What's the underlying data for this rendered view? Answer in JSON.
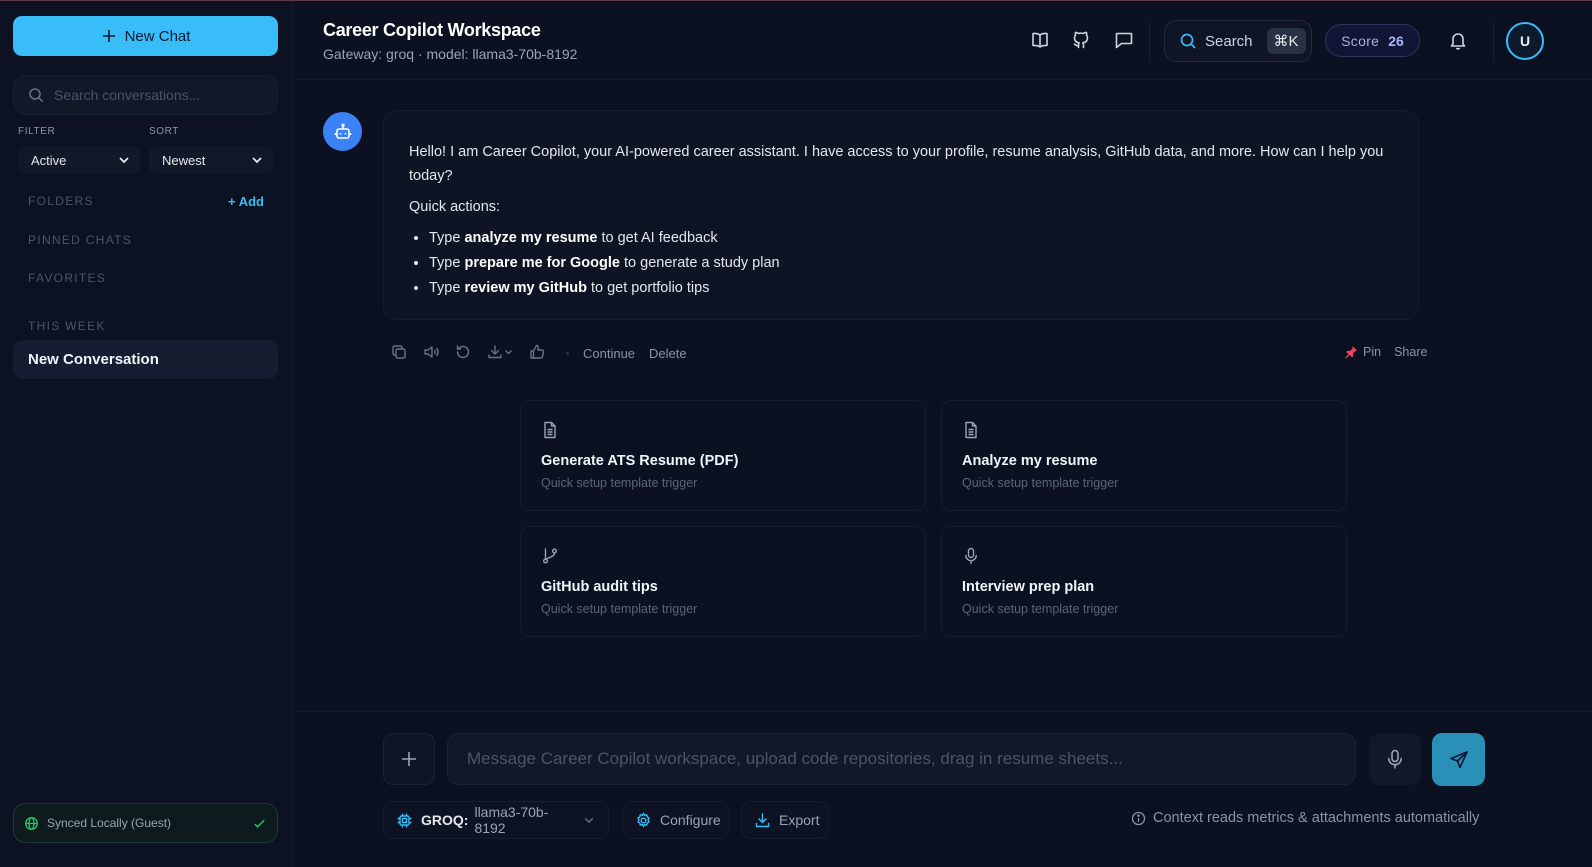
{
  "sidebar": {
    "new_chat_label": "New Chat",
    "search_placeholder": "Search conversations...",
    "filter_label": "FILTER",
    "sort_label": "SORT",
    "filter_value": "Active",
    "sort_value": "Newest",
    "folders_label": "FOLDERS",
    "add_label": "+ Add",
    "pinned_label": "PINNED CHATS",
    "favorites_label": "FAVORITES",
    "this_week_label": "THIS WEEK",
    "conversations": [
      {
        "title": "New Conversation"
      }
    ],
    "sync_status": "Synced Locally (Guest)"
  },
  "header": {
    "title": "Career Copilot Workspace",
    "subtitle": "Gateway: groq · model: llama3-70b-8192",
    "search_label": "Search",
    "search_shortcut": "⌘K",
    "score_label": "Score",
    "score_value": "26",
    "avatar_initial": "U",
    "icons": [
      "book-icon",
      "github-icon",
      "chat-bubble-icon",
      "bell-icon"
    ]
  },
  "message": {
    "intro": "Hello! I am Career Copilot, your AI-powered career assistant. I have access to your profile, resume analysis, GitHub data, and more. How can I help you today?",
    "quick_actions_label": "Quick actions:",
    "items": [
      {
        "pre": "Type ",
        "bold": "analyze my resume",
        "post": " to get AI feedback"
      },
      {
        "pre": "Type ",
        "bold": "prepare me for Google",
        "post": " to generate a study plan"
      },
      {
        "pre": "Type ",
        "bold": "review my GitHub",
        "post": " to get portfolio tips"
      }
    ],
    "actions": {
      "continue_label": "Continue",
      "delete_label": "Delete",
      "pin_label": "Pin",
      "share_label": "Share"
    }
  },
  "cards": [
    {
      "title": "Generate ATS Resume (PDF)",
      "subtitle": "Quick setup template trigger",
      "icon": "document-icon"
    },
    {
      "title": "Analyze my resume",
      "subtitle": "Quick setup template trigger",
      "icon": "document-icon"
    },
    {
      "title": "GitHub audit tips",
      "subtitle": "Quick setup template trigger",
      "icon": "git-branch-icon"
    },
    {
      "title": "Interview prep plan",
      "subtitle": "Quick setup template trigger",
      "icon": "microphone-icon"
    }
  ],
  "composer": {
    "placeholder": "Message Career Copilot workspace, upload code repositories, drag in resume sheets...",
    "provider_label": "GROQ:",
    "model_value": "llama3-70b-8192",
    "configure_label": "Configure",
    "export_label": "Export",
    "hint": "Context reads metrics & attachments automatically"
  },
  "colors": {
    "background": "#0b1120",
    "accent": "#38bdf8",
    "send_button": "#2b90b8",
    "score_text": "#a5b4fc",
    "pin": "#f43f5e"
  }
}
